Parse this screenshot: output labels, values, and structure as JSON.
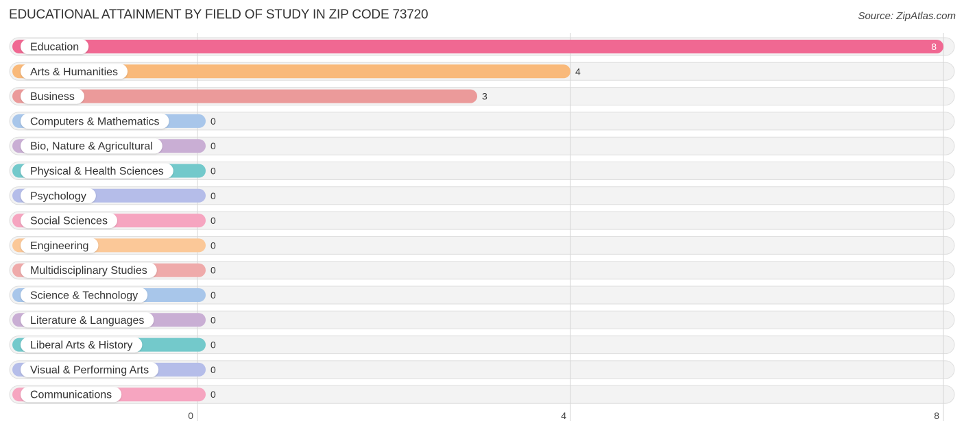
{
  "header": {
    "title": "EDUCATIONAL ATTAINMENT BY FIELD OF STUDY IN ZIP CODE 73720",
    "source": "Source: ZipAtlas.com"
  },
  "chart_data": {
    "type": "bar",
    "orientation": "horizontal",
    "title": "EDUCATIONAL ATTAINMENT BY FIELD OF STUDY IN ZIP CODE 73720",
    "xlabel": "",
    "ylabel": "",
    "xlim": [
      0,
      8
    ],
    "xticks": [
      0,
      4,
      8
    ],
    "xtick_labels": [
      "0",
      "4",
      "8"
    ],
    "grid": true,
    "categories": [
      "Education",
      "Arts & Humanities",
      "Business",
      "Computers & Mathematics",
      "Bio, Nature & Agricultural",
      "Physical & Health Sciences",
      "Psychology",
      "Social Sciences",
      "Engineering",
      "Multidisciplinary Studies",
      "Science & Technology",
      "Literature & Languages",
      "Liberal Arts & History",
      "Visual & Performing Arts",
      "Communications"
    ],
    "values": [
      8,
      4,
      3,
      0,
      0,
      0,
      0,
      0,
      0,
      0,
      0,
      0,
      0,
      0,
      0
    ],
    "value_labels": [
      "8",
      "4",
      "3",
      "0",
      "0",
      "0",
      "0",
      "0",
      "0",
      "0",
      "0",
      "0",
      "0",
      "0",
      "0"
    ],
    "colors": [
      "#f06892",
      "#f9b97a",
      "#eb9a9a",
      "#a8c6ea",
      "#c9aed4",
      "#73c9cb",
      "#b5bde9",
      "#f6a5c0",
      "#fbc898",
      "#efaaaa",
      "#a8c6ea",
      "#c9aed4",
      "#73c9cb",
      "#b5bde9",
      "#f6a5c0"
    ]
  }
}
